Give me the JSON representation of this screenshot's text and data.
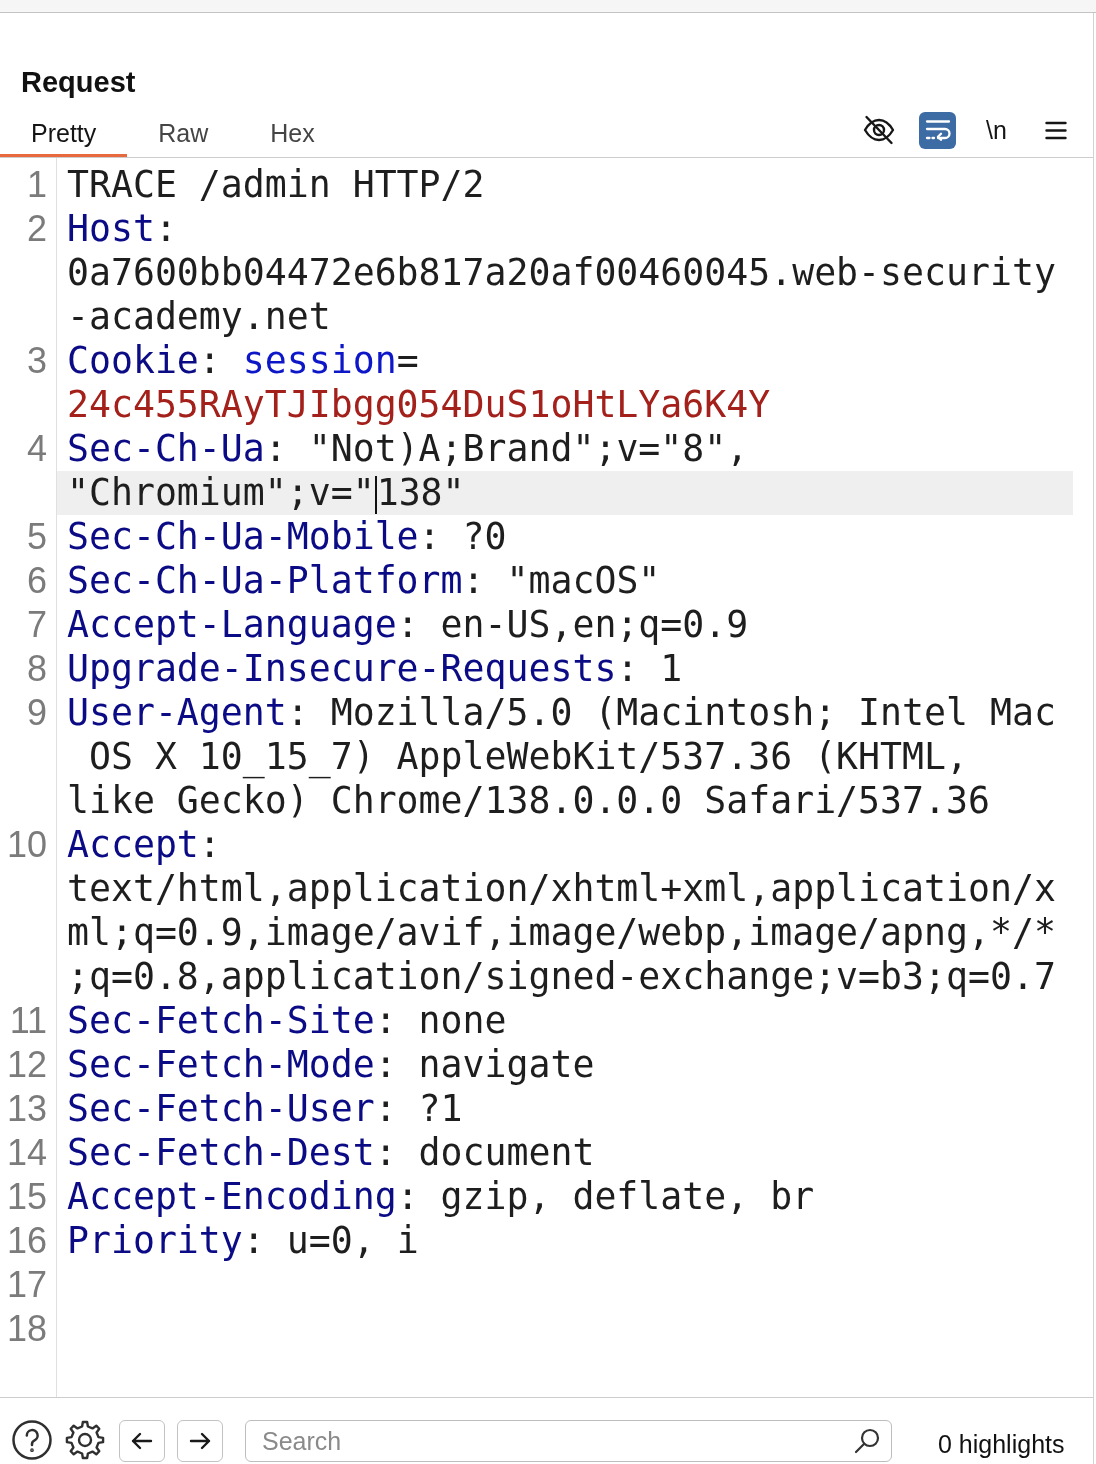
{
  "panel": {
    "title": "Request"
  },
  "tabs": [
    {
      "label": "Pretty",
      "selected": true
    },
    {
      "label": "Raw",
      "selected": false
    },
    {
      "label": "Hex",
      "selected": false
    }
  ],
  "toolbar": [
    {
      "kind": "visibility",
      "on": false
    },
    {
      "kind": "wrap",
      "on": true
    },
    {
      "kind": "newline",
      "label": "\\n",
      "on": false
    },
    {
      "kind": "menu"
    }
  ],
  "lines": [
    {
      "number": "1",
      "rows": [
        {
          "current": false,
          "tokens": [
            {
              "kind": "plain",
              "text": "TRACE /admin HTTP/2"
            }
          ]
        }
      ]
    },
    {
      "number": "2",
      "rows": [
        {
          "current": false,
          "tokens": [
            {
              "kind": "header",
              "text": "Host"
            },
            {
              "kind": "plain",
              "text": ":"
            }
          ]
        },
        {
          "current": false,
          "tokens": [
            {
              "kind": "plain",
              "text": "0a7600bb04472e6b817a20af00460045.web-security"
            }
          ]
        },
        {
          "current": false,
          "tokens": [
            {
              "kind": "plain",
              "text": "-academy.net"
            }
          ]
        }
      ]
    },
    {
      "number": "3",
      "rows": [
        {
          "current": false,
          "tokens": [
            {
              "kind": "header",
              "text": "Cookie"
            },
            {
              "kind": "plain",
              "text": ": "
            },
            {
              "kind": "param",
              "text": "session"
            },
            {
              "kind": "plain",
              "text": "="
            }
          ]
        },
        {
          "current": false,
          "tokens": [
            {
              "kind": "cookie",
              "text": "24c455RAyTJIbgg054DuS1oHtLYa6K4Y"
            }
          ]
        }
      ]
    },
    {
      "number": "4",
      "rows": [
        {
          "current": false,
          "tokens": [
            {
              "kind": "header",
              "text": "Sec-Ch-Ua"
            },
            {
              "kind": "plain",
              "text": ": \"Not)A;Brand\";v=\"8\","
            }
          ]
        },
        {
          "current": true,
          "tokens": [
            {
              "kind": "plain",
              "text": "\"Chromium\";v=\""
            },
            {
              "kind": "caret"
            },
            {
              "kind": "plain",
              "text": "138\""
            }
          ]
        }
      ]
    },
    {
      "number": "5",
      "rows": [
        {
          "current": false,
          "tokens": [
            {
              "kind": "header",
              "text": "Sec-Ch-Ua-Mobile"
            },
            {
              "kind": "plain",
              "text": ": ?0"
            }
          ]
        }
      ]
    },
    {
      "number": "6",
      "rows": [
        {
          "current": false,
          "tokens": [
            {
              "kind": "header",
              "text": "Sec-Ch-Ua-Platform"
            },
            {
              "kind": "plain",
              "text": ": \"macOS\""
            }
          ]
        }
      ]
    },
    {
      "number": "7",
      "rows": [
        {
          "current": false,
          "tokens": [
            {
              "kind": "header",
              "text": "Accept-Language"
            },
            {
              "kind": "plain",
              "text": ": en-US,en;q=0.9"
            }
          ]
        }
      ]
    },
    {
      "number": "8",
      "rows": [
        {
          "current": false,
          "tokens": [
            {
              "kind": "header",
              "text": "Upgrade-Insecure-Requests"
            },
            {
              "kind": "plain",
              "text": ": 1"
            }
          ]
        }
      ]
    },
    {
      "number": "9",
      "rows": [
        {
          "current": false,
          "tokens": [
            {
              "kind": "header",
              "text": "User-Agent"
            },
            {
              "kind": "plain",
              "text": ": Mozilla/5.0 (Macintosh; Intel Mac"
            }
          ]
        },
        {
          "current": false,
          "tokens": [
            {
              "kind": "plain",
              "text": " OS X 10_15_7) AppleWebKit/537.36 (KHTML,"
            }
          ]
        },
        {
          "current": false,
          "tokens": [
            {
              "kind": "plain",
              "text": "like Gecko) Chrome/138.0.0.0 Safari/537.36"
            }
          ]
        }
      ]
    },
    {
      "number": "10",
      "rows": [
        {
          "current": false,
          "tokens": [
            {
              "kind": "header",
              "text": "Accept"
            },
            {
              "kind": "plain",
              "text": ":"
            }
          ]
        },
        {
          "current": false,
          "tokens": [
            {
              "kind": "plain",
              "text": "text/html,application/xhtml+xml,application/x"
            }
          ]
        },
        {
          "current": false,
          "tokens": [
            {
              "kind": "plain",
              "text": "ml;q=0.9,image/avif,image/webp,image/apng,*/*"
            }
          ]
        },
        {
          "current": false,
          "tokens": [
            {
              "kind": "plain",
              "text": ";q=0.8,application/signed-exchange;v=b3;q=0.7"
            }
          ]
        }
      ]
    },
    {
      "number": "11",
      "rows": [
        {
          "current": false,
          "tokens": [
            {
              "kind": "header",
              "text": "Sec-Fetch-Site"
            },
            {
              "kind": "plain",
              "text": ": none"
            }
          ]
        }
      ]
    },
    {
      "number": "12",
      "rows": [
        {
          "current": false,
          "tokens": [
            {
              "kind": "header",
              "text": "Sec-Fetch-Mode"
            },
            {
              "kind": "plain",
              "text": ": navigate"
            }
          ]
        }
      ]
    },
    {
      "number": "13",
      "rows": [
        {
          "current": false,
          "tokens": [
            {
              "kind": "header",
              "text": "Sec-Fetch-User"
            },
            {
              "kind": "plain",
              "text": ": ?1"
            }
          ]
        }
      ]
    },
    {
      "number": "14",
      "rows": [
        {
          "current": false,
          "tokens": [
            {
              "kind": "header",
              "text": "Sec-Fetch-Dest"
            },
            {
              "kind": "plain",
              "text": ": document"
            }
          ]
        }
      ]
    },
    {
      "number": "15",
      "rows": [
        {
          "current": false,
          "tokens": [
            {
              "kind": "header",
              "text": "Accept-Encoding"
            },
            {
              "kind": "plain",
              "text": ": gzip, deflate, br"
            }
          ]
        }
      ]
    },
    {
      "number": "16",
      "rows": [
        {
          "current": false,
          "tokens": [
            {
              "kind": "header",
              "text": "Priority"
            },
            {
              "kind": "plain",
              "text": ": u=0, i"
            }
          ]
        }
      ]
    },
    {
      "number": "17"
    },
    {
      "number": "18"
    }
  ],
  "footer": {
    "search": {
      "placeholder": "Search"
    },
    "highlights": "0 highlights"
  }
}
